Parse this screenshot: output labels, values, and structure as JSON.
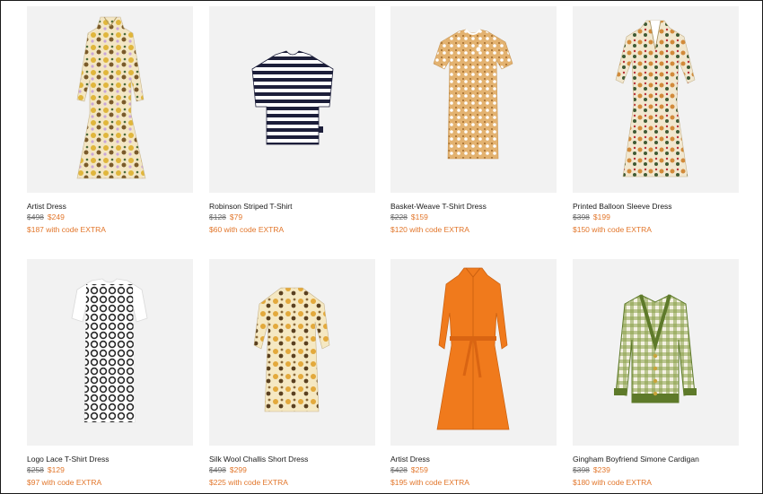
{
  "theme": {
    "sale_color": "#e2762b",
    "image_bg": "#f2f2f2"
  },
  "products": [
    {
      "name": "Artist Dress",
      "was": "$498",
      "now": "$249",
      "promo": "$187 with code EXTRA",
      "image_icon": "floral-dress-icon"
    },
    {
      "name": "Robinson Striped T-Shirt",
      "was": "$128",
      "now": "$79",
      "promo": "$60 with code EXTRA",
      "image_icon": "striped-tshirt-icon"
    },
    {
      "name": "Basket-Weave T-Shirt Dress",
      "was": "$228",
      "now": "$159",
      "promo": "$120 with code EXTRA",
      "image_icon": "tshirt-dress-icon"
    },
    {
      "name": "Printed Balloon Sleeve Dress",
      "was": "$398",
      "now": "$199",
      "promo": "$150 with code EXTRA",
      "image_icon": "balloon-sleeve-dress-icon"
    },
    {
      "name": "Logo Lace T-Shirt Dress",
      "was": "$258",
      "now": "$129",
      "promo": "$97 with code EXTRA",
      "image_icon": "lace-tshirt-dress-icon"
    },
    {
      "name": "Silk Wool Challis Short Dress",
      "was": "$498",
      "now": "$299",
      "promo": "$225 with code EXTRA",
      "image_icon": "short-dress-icon"
    },
    {
      "name": "Artist Dress",
      "was": "$428",
      "now": "$259",
      "promo": "$195 with code EXTRA",
      "image_icon": "shirt-dress-icon"
    },
    {
      "name": "Gingham Boyfriend Simone Cardigan",
      "was": "$398",
      "now": "$239",
      "promo": "$180 with code EXTRA",
      "image_icon": "cardigan-icon"
    }
  ]
}
